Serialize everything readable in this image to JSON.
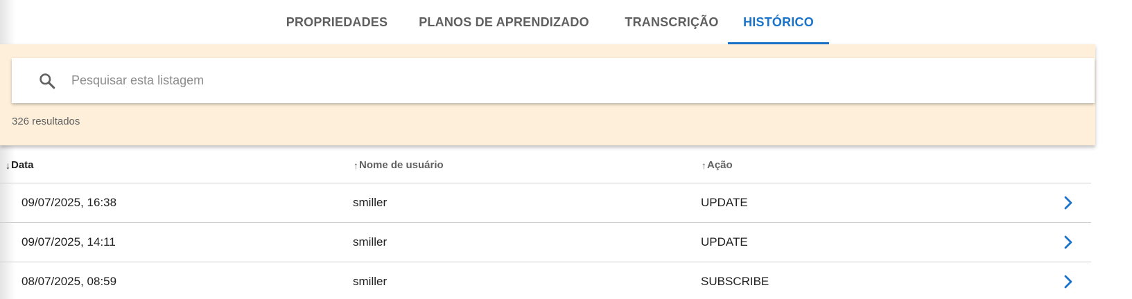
{
  "tabs": [
    {
      "label": "PROPRIEDADES"
    },
    {
      "label": "PLANOS DE APRENDIZADO"
    },
    {
      "label": "TRANSCRIÇÃO"
    },
    {
      "label": "HISTÓRICO",
      "active": true
    }
  ],
  "search": {
    "placeholder": "Pesquisar esta listagem",
    "value": "",
    "result_count": "326 resultados"
  },
  "table": {
    "columns": [
      {
        "label": "Data",
        "sort": "desc",
        "arrow": "↓"
      },
      {
        "label": "Nome de usuário",
        "sort": "asc",
        "arrow": "↑"
      },
      {
        "label": "Ação",
        "sort": "asc",
        "arrow": "↑"
      }
    ],
    "rows": [
      {
        "date": "09/07/2025, 16:38",
        "user": "smiller",
        "action": "UPDATE"
      },
      {
        "date": "09/07/2025, 14:11",
        "user": "smiller",
        "action": "UPDATE"
      },
      {
        "date": "08/07/2025, 08:59",
        "user": "smiller",
        "action": "SUBSCRIBE"
      }
    ]
  },
  "icons": {
    "search": "search-icon",
    "row_open": "chevron-right-icon"
  },
  "colors": {
    "accent": "#1a73c9",
    "panel_background": "#fdefd9",
    "inactive_tab": "#5f5f5f"
  }
}
